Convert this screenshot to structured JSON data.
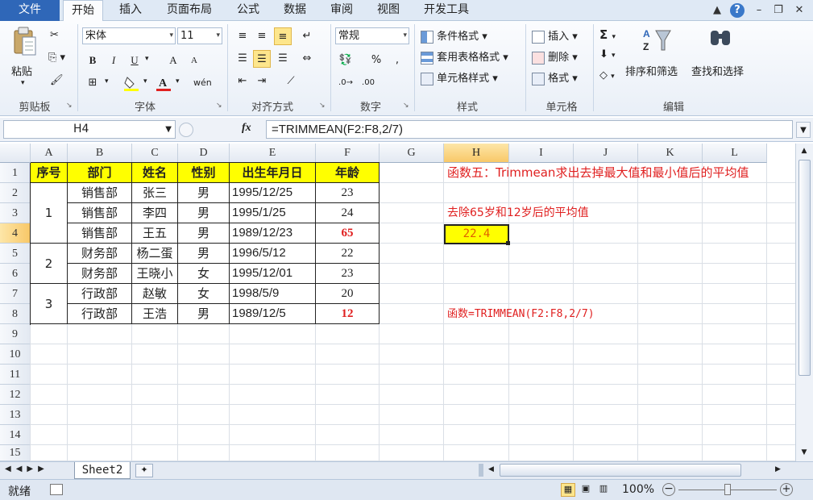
{
  "menu": {
    "tabs": [
      "文件",
      "开始",
      "插入",
      "页面布局",
      "公式",
      "数据",
      "审阅",
      "视图",
      "开发工具"
    ]
  },
  "ribbon": {
    "clipboard": {
      "paste": "粘贴",
      "label": "剪贴板"
    },
    "font": {
      "name": "宋体",
      "size": "11",
      "label": "字体",
      "bold": "B",
      "italic": "I",
      "underline": "U",
      "grow": "A",
      "shrink": "A"
    },
    "alignment": {
      "label": "对齐方式"
    },
    "number": {
      "format": "常规",
      "label": "数字",
      "percent": "%",
      "comma": ","
    },
    "styles": {
      "conditional": "条件格式",
      "table": "套用表格格式",
      "cell": "单元格样式",
      "label": "样式"
    },
    "cells": {
      "insert": "插入",
      "delete": "删除",
      "format": "格式",
      "label": "单元格"
    },
    "editing": {
      "sum": "Σ",
      "sort": "排序和筛选",
      "find": "查找和选择",
      "label": "编辑"
    }
  },
  "formula_bar": {
    "name_box": "H4",
    "fx": "fx",
    "formula": "=TRIMMEAN(F2:F8,2/7)"
  },
  "columns": [
    "A",
    "B",
    "C",
    "D",
    "E",
    "F",
    "G",
    "H",
    "I",
    "J",
    "K",
    "L"
  ],
  "rows": [
    "1",
    "2",
    "3",
    "4",
    "5",
    "6",
    "7",
    "8",
    "9",
    "10",
    "11",
    "12",
    "13",
    "14",
    "15"
  ],
  "table": {
    "headers": [
      "序号",
      "部门",
      "姓名",
      "性别",
      "出生年月日",
      "年龄"
    ],
    "groups": [
      "1",
      "2",
      "3"
    ],
    "records": [
      [
        "销售部",
        "张三",
        "男",
        "1995/12/25",
        "23"
      ],
      [
        "销售部",
        "李四",
        "男",
        "1995/1/25",
        "24"
      ],
      [
        "销售部",
        "王五",
        "男",
        "1989/12/23",
        "65"
      ],
      [
        "财务部",
        "杨二蛋",
        "男",
        "1996/5/12",
        "22"
      ],
      [
        "财务部",
        "王晓小",
        "女",
        "1995/12/01",
        "23"
      ],
      [
        "行政部",
        "赵敏",
        "女",
        "1998/5/9",
        "20"
      ],
      [
        "行政部",
        "王浩",
        "男",
        "1989/12/5",
        "12"
      ]
    ]
  },
  "notes": {
    "h1": "函数五：Trimmean求出去掉最大值和最小值后的平均值",
    "h3": "去除65岁和12岁后的平均值",
    "h4": "22.4",
    "h8": "函数=TRIMMEAN(F2:F8,2/7)"
  },
  "sheet_tabs": {
    "sheet": "Sheet2"
  },
  "status": {
    "ready": "就绪",
    "zoom": "100%"
  },
  "colors": {
    "header_yellow": "#ffff00",
    "red": "#e02020",
    "selected": "#f8c868",
    "file_tab": "#2f67b8"
  }
}
